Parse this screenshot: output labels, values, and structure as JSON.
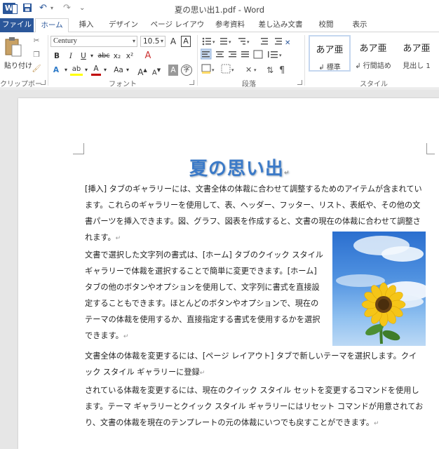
{
  "titlebar": {
    "title": "夏の思い出1.pdf - Word",
    "app_icon": "W",
    "save_icon": "💾",
    "undo_icon": "↶",
    "redo_icon": "↷",
    "customize_icon": "⌄"
  },
  "tabs": [
    "ファイル",
    "ホーム",
    "挿入",
    "デザイン",
    "ページ レイアウト",
    "参考資料",
    "差し込み文書",
    "校閲",
    "表示"
  ],
  "clipboard": {
    "paste_label": "貼り付け",
    "group_label": "クリップボード"
  },
  "font": {
    "name": "Century",
    "size": "10.5",
    "group_label": "フォント",
    "buttons": [
      "B",
      "I",
      "U",
      "abc",
      "x₂",
      "x²"
    ],
    "grow": "A",
    "shrink": "A",
    "case": "Aa",
    "color_a": "A",
    "highlight": "ab",
    "letter_a": "A",
    "char_shade": "A",
    "enclose": "字",
    "clear_format": "A"
  },
  "paragraph": {
    "group_label": "段落"
  },
  "styles": {
    "group_label": "スタイル",
    "items": [
      {
        "sample": "あア亜",
        "name": "↲ 標準"
      },
      {
        "sample": "あア亜",
        "name": "↲ 行間詰め"
      },
      {
        "sample": "あア亜",
        "name": "見出し 1"
      }
    ]
  },
  "document": {
    "title": "夏の思い出",
    "para1": "[挿入] タブのギャラリーには、文書全体の体裁に合わせて調整するためのアイテムが含まれています。これらのギャラリーを使用して、表、ヘッダー、フッター、リスト、表紙や、その他の文書パーツを挿入できます。図、グラフ、図表を作成すると、文書の現在の体裁に合わせて調整されます。",
    "para2": "文書で選択した文字列の書式は、[ホーム] タブのクイック スタイル ギャラリーで体裁を選択することで簡単に変更できます。[ホーム] タブの他のボタンやオプションを使用して、文字列に書式を直接設定することもできます。ほとんどのボタンやオプションで、現在のテーマの体裁を使用するか、直接指定する書式を使用するかを選択できます。",
    "para3": "文書全体の体裁を変更するには、[ページ レイアウト] タブで新しいテーマを選択します。クイック スタイル ギャラリーに登録",
    "para4": "されている体裁を変更するには、現在のクイック スタイル セットを変更するコマンドを使用します。テーマ ギャラリーとクイック スタイル ギャラリーにはリセット コマンドが用意されており、文書の体裁を現在のテンプレートの元の体裁にいつでも戻すことができます。",
    "para_mark": "↵",
    "image": "sunflower-photo"
  },
  "colors": {
    "accent": "#2b579a",
    "font_color": "#c00000",
    "highlight": "#ffff00",
    "title_blue": "#3b7ac8"
  }
}
